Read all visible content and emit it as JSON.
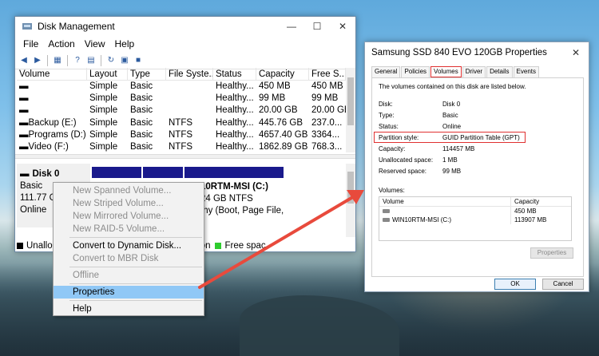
{
  "disk_mgmt": {
    "title": "Disk Management",
    "menu": [
      "File",
      "Action",
      "View",
      "Help"
    ],
    "columns": [
      "Volume",
      "Layout",
      "Type",
      "File Syste...",
      "Status",
      "Capacity",
      "Free S..."
    ],
    "rows": [
      {
        "volume": "",
        "layout": "Simple",
        "type": "Basic",
        "fs": "",
        "status": "Healthy...",
        "capacity": "450 MB",
        "free": "450 MB"
      },
      {
        "volume": "",
        "layout": "Simple",
        "type": "Basic",
        "fs": "",
        "status": "Healthy...",
        "capacity": "99 MB",
        "free": "99 MB"
      },
      {
        "volume": "",
        "layout": "Simple",
        "type": "Basic",
        "fs": "",
        "status": "Healthy...",
        "capacity": "20.00 GB",
        "free": "20.00 GB"
      },
      {
        "volume": "Backup (E:)",
        "layout": "Simple",
        "type": "Basic",
        "fs": "NTFS",
        "status": "Healthy...",
        "capacity": "445.76 GB",
        "free": "237.0..."
      },
      {
        "volume": "Programs (D:)",
        "layout": "Simple",
        "type": "Basic",
        "fs": "NTFS",
        "status": "Healthy...",
        "capacity": "4657.40 GB",
        "free": "3364..."
      },
      {
        "volume": "Video (F:)",
        "layout": "Simple",
        "type": "Basic",
        "fs": "NTFS",
        "status": "Healthy...",
        "capacity": "1862.89 GB",
        "free": "768.3..."
      }
    ],
    "disk0": {
      "name": "Disk 0",
      "type": "Basic",
      "size": "111.77 G",
      "status": "Online",
      "partition_name": "10RTM-MSI  (C:)",
      "partition_size": "24 GB NTFS",
      "partition_status": "thy (Boot, Page File,"
    },
    "legend": {
      "unalloc": "Unalloc",
      "primary_tail": "rtition",
      "free": "Free spac"
    }
  },
  "context_menu": {
    "items": [
      {
        "label": "New Spanned Volume...",
        "disabled": true
      },
      {
        "label": "New Striped Volume...",
        "disabled": true
      },
      {
        "label": "New Mirrored Volume...",
        "disabled": true
      },
      {
        "label": "New RAID-5 Volume...",
        "disabled": true
      },
      {
        "label": "Convert to Dynamic Disk...",
        "disabled": false
      },
      {
        "label": "Convert to MBR Disk",
        "disabled": true
      },
      {
        "label": "Offline",
        "disabled": true
      },
      {
        "label": "Properties",
        "disabled": false,
        "highlighted": true
      },
      {
        "label": "Help",
        "disabled": false
      }
    ]
  },
  "properties": {
    "title": "Samsung SSD 840 EVO 120GB Properties",
    "tabs": [
      "General",
      "Policies",
      "Volumes",
      "Driver",
      "Details",
      "Events"
    ],
    "active_tab": "Volumes",
    "description": "The volumes contained on this disk are listed below.",
    "fields": [
      {
        "key": "Disk:",
        "value": "Disk 0"
      },
      {
        "key": "Type:",
        "value": "Basic"
      },
      {
        "key": "Status:",
        "value": "Online"
      },
      {
        "key": "Partition style:",
        "value": "GUID Partition Table (GPT)"
      },
      {
        "key": "Capacity:",
        "value": "114457 MB"
      },
      {
        "key": "Unallocated space:",
        "value": "1 MB"
      },
      {
        "key": "Reserved space:",
        "value": "99 MB"
      }
    ],
    "volumes_label": "Volumes:",
    "vol_headers": [
      "Volume",
      "Capacity"
    ],
    "vol_rows": [
      {
        "name": "",
        "capacity": "450 MB"
      },
      {
        "name": "WIN10RTM-MSI (C:)",
        "capacity": "113907 MB"
      }
    ],
    "properties_btn": "Properties",
    "ok_btn": "OK",
    "cancel_btn": "Cancel"
  },
  "colors": {
    "accent_red": "#e03030",
    "partition_blue": "#1a1a8c",
    "highlight": "#90c8f6"
  }
}
